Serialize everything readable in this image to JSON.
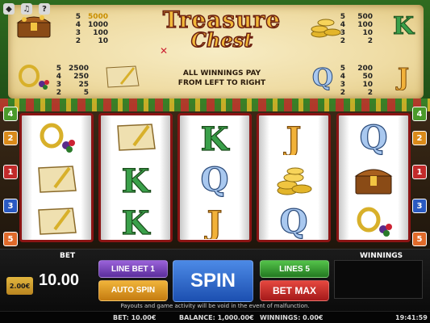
{
  "top_icons": [
    "◆",
    "♫",
    "?"
  ],
  "logo": {
    "line1": "Treasure",
    "line2": "Chest"
  },
  "paytable_text": [
    "ALL WINNINGS PAY",
    "FROM LEFT TO RIGHT"
  ],
  "paytable": {
    "chest": [
      [
        "5",
        "5000"
      ],
      [
        "4",
        "1000"
      ],
      [
        "3",
        "100"
      ],
      [
        "2",
        "10"
      ]
    ],
    "ring": [
      [
        "5",
        "2500"
      ],
      [
        "4",
        "250"
      ],
      [
        "3",
        "25"
      ],
      [
        "2",
        "5"
      ]
    ],
    "coins": [
      [
        "5",
        "500"
      ],
      [
        "4",
        "100"
      ],
      [
        "3",
        "10"
      ],
      [
        "2",
        "2"
      ]
    ],
    "k": [
      [
        "5",
        "200"
      ],
      [
        "4",
        "50"
      ],
      [
        "3",
        "10"
      ],
      [
        "2",
        "2"
      ]
    ]
  },
  "line_indicators": {
    "left": [
      "4",
      "2",
      "1",
      "3",
      "5"
    ],
    "right": [
      "4",
      "2",
      "1",
      "3",
      "5"
    ]
  },
  "reels": [
    [
      "ring",
      "map",
      "map"
    ],
    [
      "map",
      "K",
      "K"
    ],
    [
      "K",
      "Q",
      "J"
    ],
    [
      "J",
      "coins",
      "Q"
    ],
    [
      "Q",
      "chest",
      "ring"
    ]
  ],
  "controls": {
    "chip_value": "2.00€",
    "bet_label": "BET",
    "bet_value": "10.00",
    "line_bet": "LINE BET 1",
    "auto_spin": "AUTO SPIN",
    "spin": "SPIN",
    "lines": "LINES 5",
    "bet_max": "BET MAX",
    "winnings_label": "WINNINGS"
  },
  "disclaimer": "Payouts and game activity will be void in the event of malfunction.",
  "status": {
    "bet": "BET: 10.00€",
    "balance": "BALANCE: 1,000.00€",
    "winnings": "WINNINGS: 0.00€",
    "time": "19:41:59"
  }
}
